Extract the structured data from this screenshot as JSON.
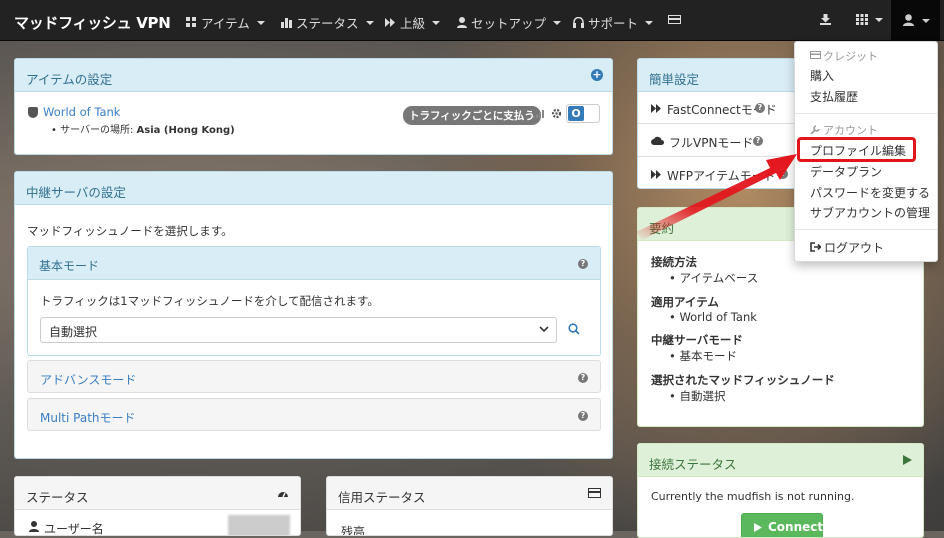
{
  "nav": {
    "brand": "マッドフィッシュ VPN",
    "items": [
      "アイテム",
      "ステータス",
      "上級",
      "セットアップ",
      "サポート"
    ]
  },
  "item_settings": {
    "title": "アイテムの設定",
    "game": "World of Tank",
    "server_label": "サーバーの場所:",
    "server_value": "Asia (Hong Kong)",
    "badge": "トラフィックごとに支払う",
    "toggle": "O"
  },
  "relay": {
    "title": "中継サーバの設定",
    "desc": "マッドフィッシュノードを選択します。",
    "basic_title": "基本モード",
    "basic_desc": "トラフィックは1マッドフィッシュノードを介して配信されます。",
    "select_value": "自動選択",
    "advanced": "アドバンスモード",
    "multipath": "Multi Pathモード"
  },
  "status": {
    "title": "ステータス",
    "user_label": "ユーザー名"
  },
  "credit_status": {
    "title": "信用ステータス",
    "row": "残高"
  },
  "easy": {
    "title": "簡単設定",
    "items": [
      "FastConnectモード",
      "フルVPNモード",
      "WFPアイテムモード"
    ]
  },
  "summary": {
    "title": "要約",
    "sections": [
      {
        "h": "接続方法",
        "v": "アイテムベース"
      },
      {
        "h": "適用アイテム",
        "v": "World of Tank"
      },
      {
        "h": "中継サーバモード",
        "v": "基本モード"
      },
      {
        "h": "選択されたマッドフィッシュノード",
        "v": "自動選択"
      }
    ]
  },
  "conn": {
    "title": "接続ステータス",
    "msg": "Currently the mudfish is not running.",
    "button": "Connect"
  },
  "dropdown": {
    "credit_header": "クレジット",
    "credit_items": [
      "購入",
      "支払履歴"
    ],
    "account_header": "アカウント",
    "account_items": [
      "プロファイル編集",
      "データプラン",
      "パスワードを変更する",
      "サブアカウントの管理"
    ],
    "logout": "ログアウト"
  },
  "colors": {
    "highlight": "#e3151c",
    "arrow": "#e3151c",
    "accent": "#31708f",
    "success": "#5cb85c"
  }
}
